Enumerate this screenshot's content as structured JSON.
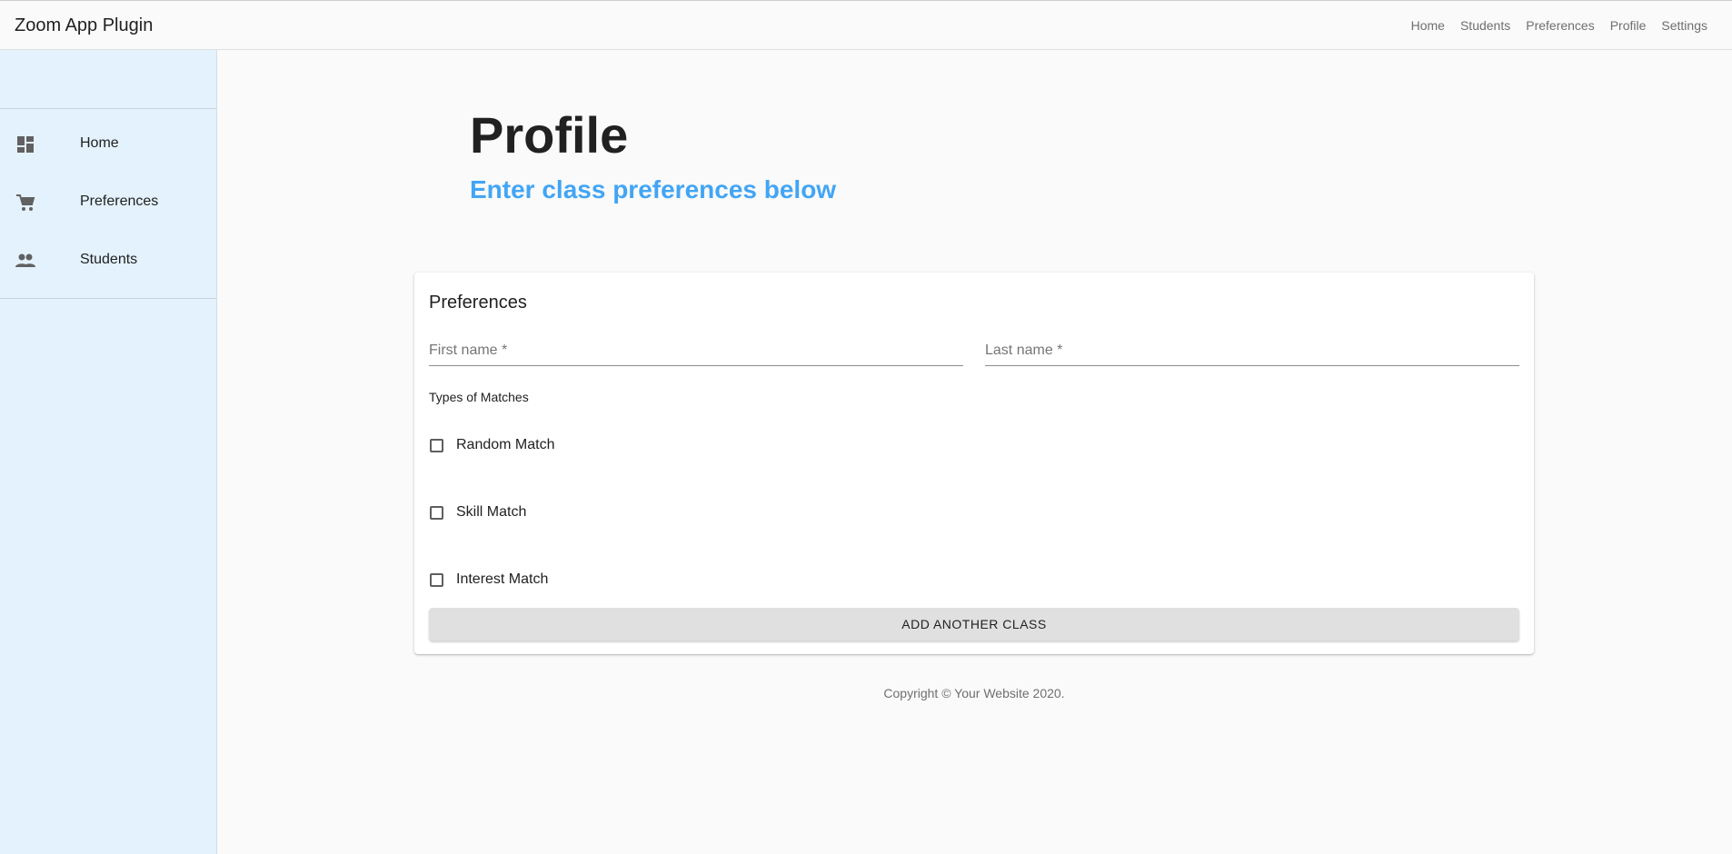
{
  "app": {
    "title": "Zoom App Plugin"
  },
  "topnav": {
    "items": [
      {
        "label": "Home"
      },
      {
        "label": "Students"
      },
      {
        "label": "Preferences"
      },
      {
        "label": "Profile"
      },
      {
        "label": "Settings"
      }
    ]
  },
  "sidebar": {
    "items": [
      {
        "label": "Home",
        "icon": "dashboard-icon"
      },
      {
        "label": "Preferences",
        "icon": "cart-icon"
      },
      {
        "label": "Students",
        "icon": "people-icon"
      }
    ]
  },
  "hero": {
    "title": "Profile",
    "subtitle": "Enter class preferences below"
  },
  "form": {
    "title": "Preferences",
    "first_name_placeholder": "First name *",
    "last_name_placeholder": "Last name *",
    "first_name_value": "",
    "last_name_value": "",
    "section_label": "Types of Matches",
    "options": [
      {
        "label": "Random Match",
        "checked": false
      },
      {
        "label": "Skill Match",
        "checked": false
      },
      {
        "label": "Interest Match",
        "checked": false
      }
    ],
    "add_button": "ADD ANOTHER CLASS"
  },
  "footer": {
    "text": "Copyright © Your Website 2020."
  },
  "colors": {
    "accent": "#42a5f5",
    "sidebar_bg": "#e3f2fd",
    "icon": "#616161"
  }
}
